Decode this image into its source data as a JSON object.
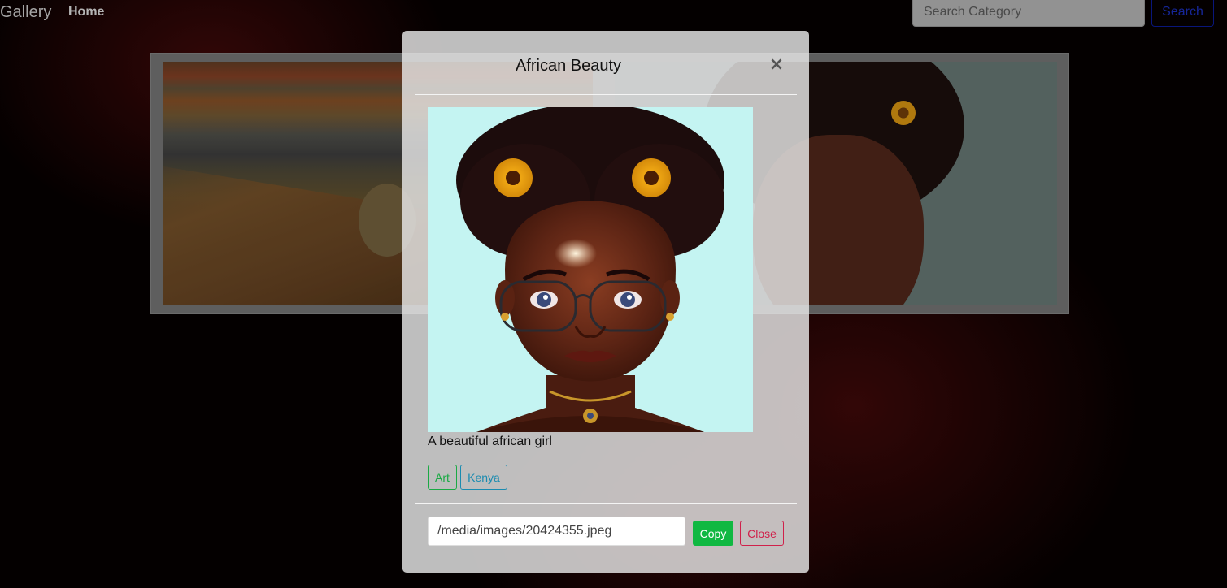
{
  "navbar": {
    "brand": "Gallery",
    "home_label": "Home",
    "search_placeholder": "Search Category",
    "search_button": "Search"
  },
  "modal": {
    "title": "African Beauty",
    "close_icon": "×",
    "image_alt": "African Beauty",
    "caption": "A beautiful african girl",
    "tags": [
      {
        "label": "Art",
        "color": "#1aaa44"
      },
      {
        "label": "Kenya",
        "color": "#1a8bb0"
      }
    ],
    "image_url": "/media/images/20424355.jpeg",
    "copy_button": "Copy",
    "close_button": "Close"
  },
  "colors": {
    "copy_button_bg": "#10b842",
    "close_button_border": "#d0204a"
  }
}
